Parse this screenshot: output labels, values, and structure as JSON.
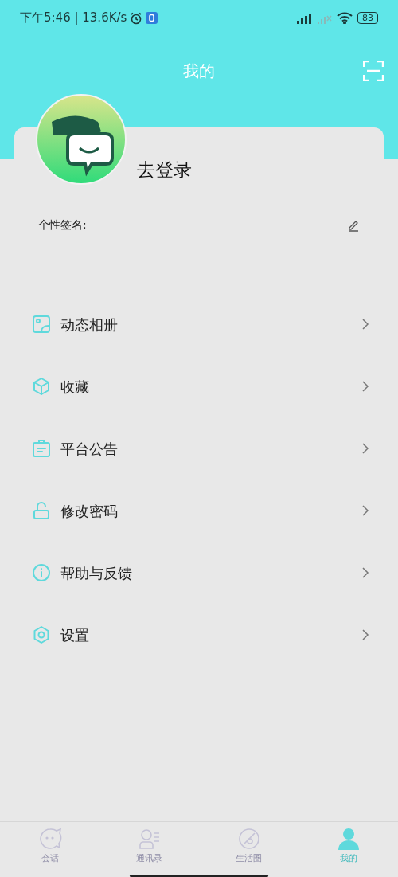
{
  "status_bar": {
    "time": "下午5:46 | 13.6K/s",
    "battery": "83"
  },
  "header": {
    "title": "我的"
  },
  "profile": {
    "login": "去登录",
    "signature_label": "个性签名:"
  },
  "menu": [
    {
      "kind": "album",
      "label": "动态相册"
    },
    {
      "kind": "favorite",
      "label": "收藏"
    },
    {
      "kind": "notice",
      "label": "平台公告"
    },
    {
      "kind": "password",
      "label": "修改密码"
    },
    {
      "kind": "help",
      "label": "帮助与反馈"
    },
    {
      "kind": "settings",
      "label": "设置"
    }
  ],
  "tab_bar": [
    {
      "kind": "chat",
      "label": "会话",
      "selected": false
    },
    {
      "kind": "contacts",
      "label": "通讯录",
      "selected": false
    },
    {
      "kind": "moments",
      "label": "生活圈",
      "selected": false
    },
    {
      "kind": "me",
      "label": "我的",
      "selected": true
    }
  ]
}
